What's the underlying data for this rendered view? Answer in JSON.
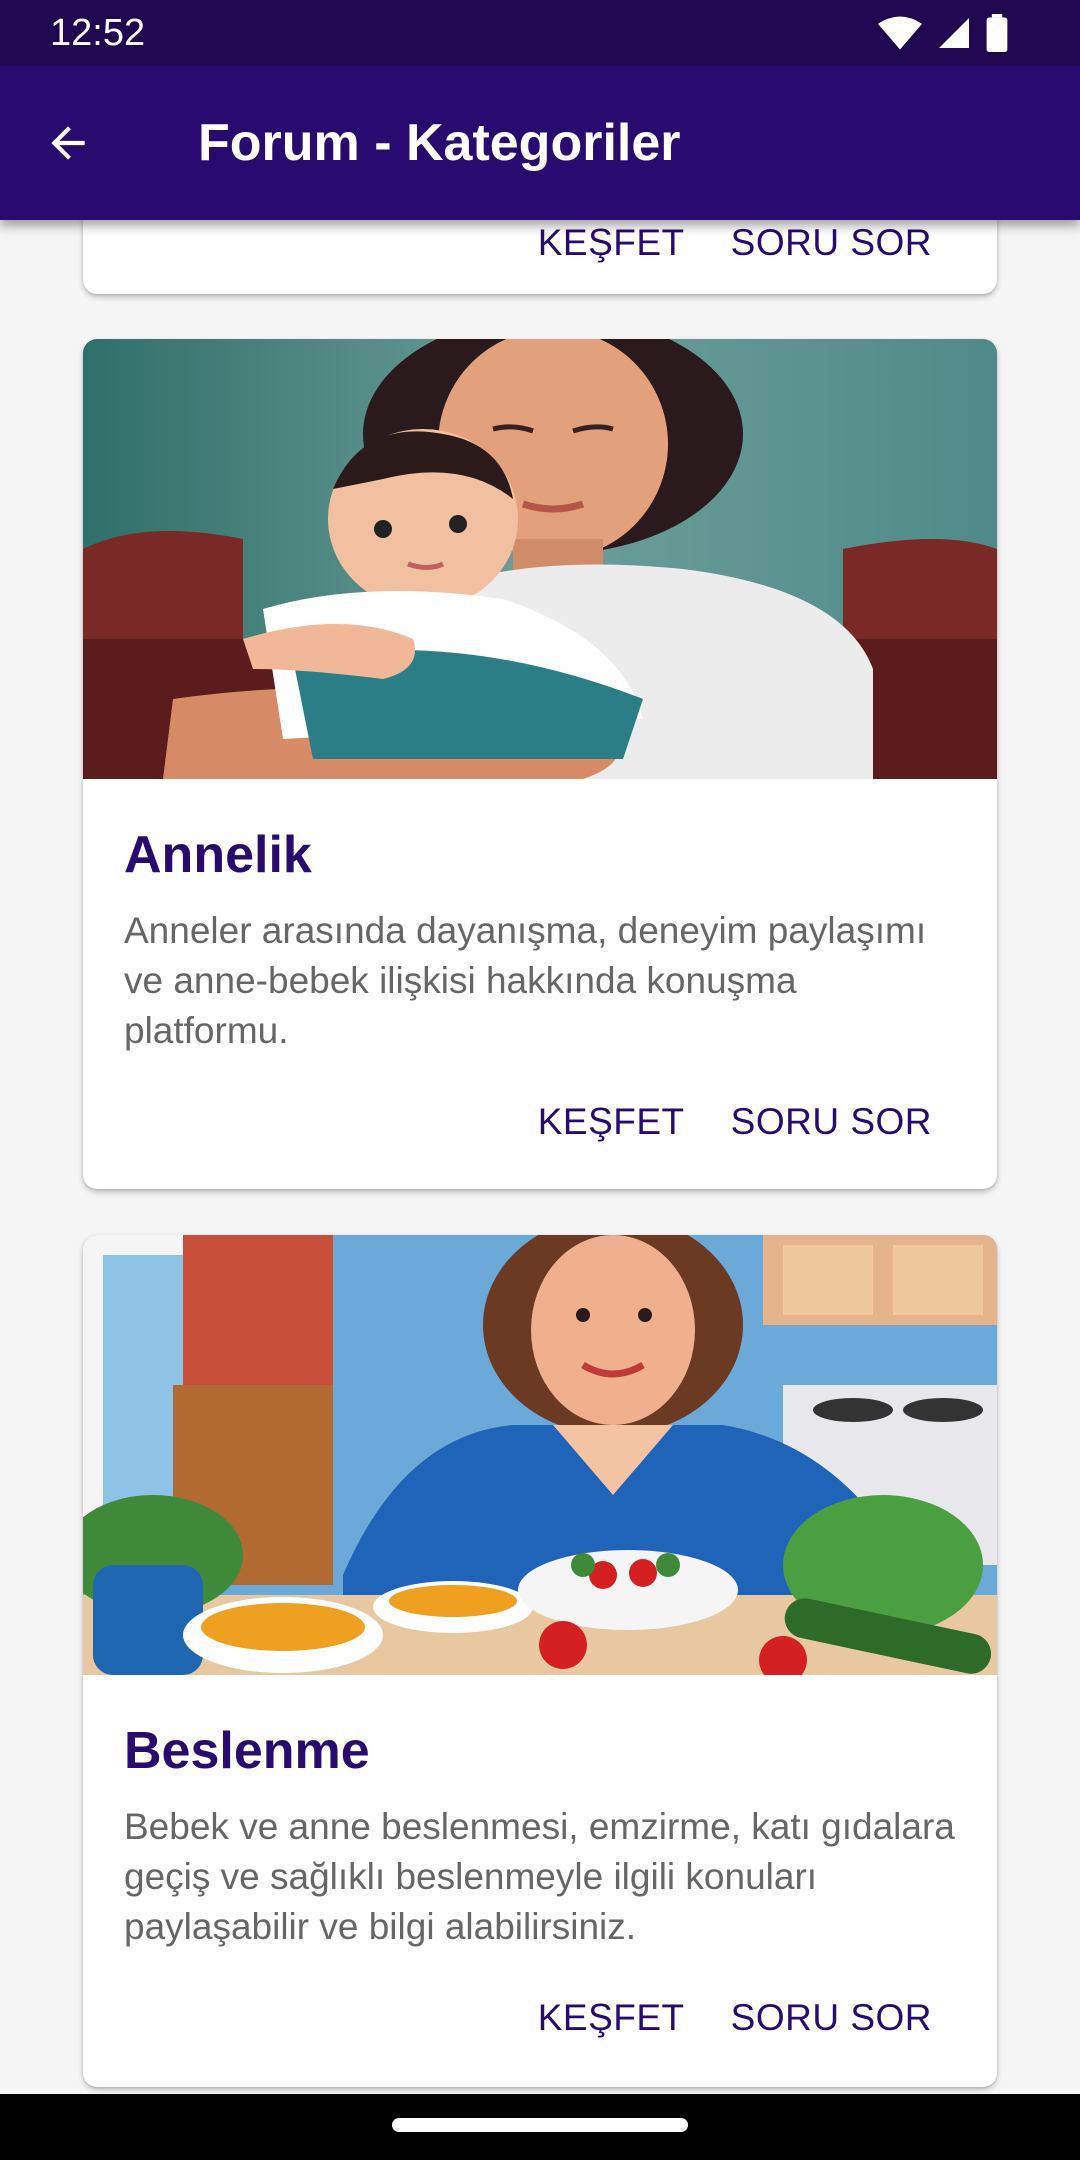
{
  "status_bar": {
    "time": "12:52",
    "icons": [
      "wifi-icon",
      "signal-icon",
      "battery-icon"
    ]
  },
  "app_bar": {
    "back_icon": "arrow-left-icon",
    "title": "Forum - Kategoriler"
  },
  "cards": [
    {
      "title": "",
      "description": "",
      "explore_label": "KEŞFET",
      "ask_label": "SORU SOR",
      "image": "partially scrolled card"
    },
    {
      "title": "Annelik",
      "description": "Anneler arasında dayanışma, deneyim paylaşımı ve anne-bebek ilişkisi hakkında konuşma platformu.",
      "explore_label": "KEŞFET",
      "ask_label": "SORU SOR",
      "image": "mother holding baby illustration"
    },
    {
      "title": "Beslenme",
      "description": "Bebek ve anne beslenmesi, emzirme, katı gıdalara geçiş ve sağlıklı beslenmeyle ilgili konuları paylaşabilir ve bilgi alabilirsiniz.",
      "explore_label": "KEŞFET",
      "ask_label": "SORU SOR",
      "image": "woman at table with vegetables and soup illustration"
    }
  ],
  "colors": {
    "status_bar": "#1f0751",
    "app_bar": "#270b6e",
    "accent": "#270b6e",
    "background": "#f5f5f5",
    "description": "#666666"
  }
}
